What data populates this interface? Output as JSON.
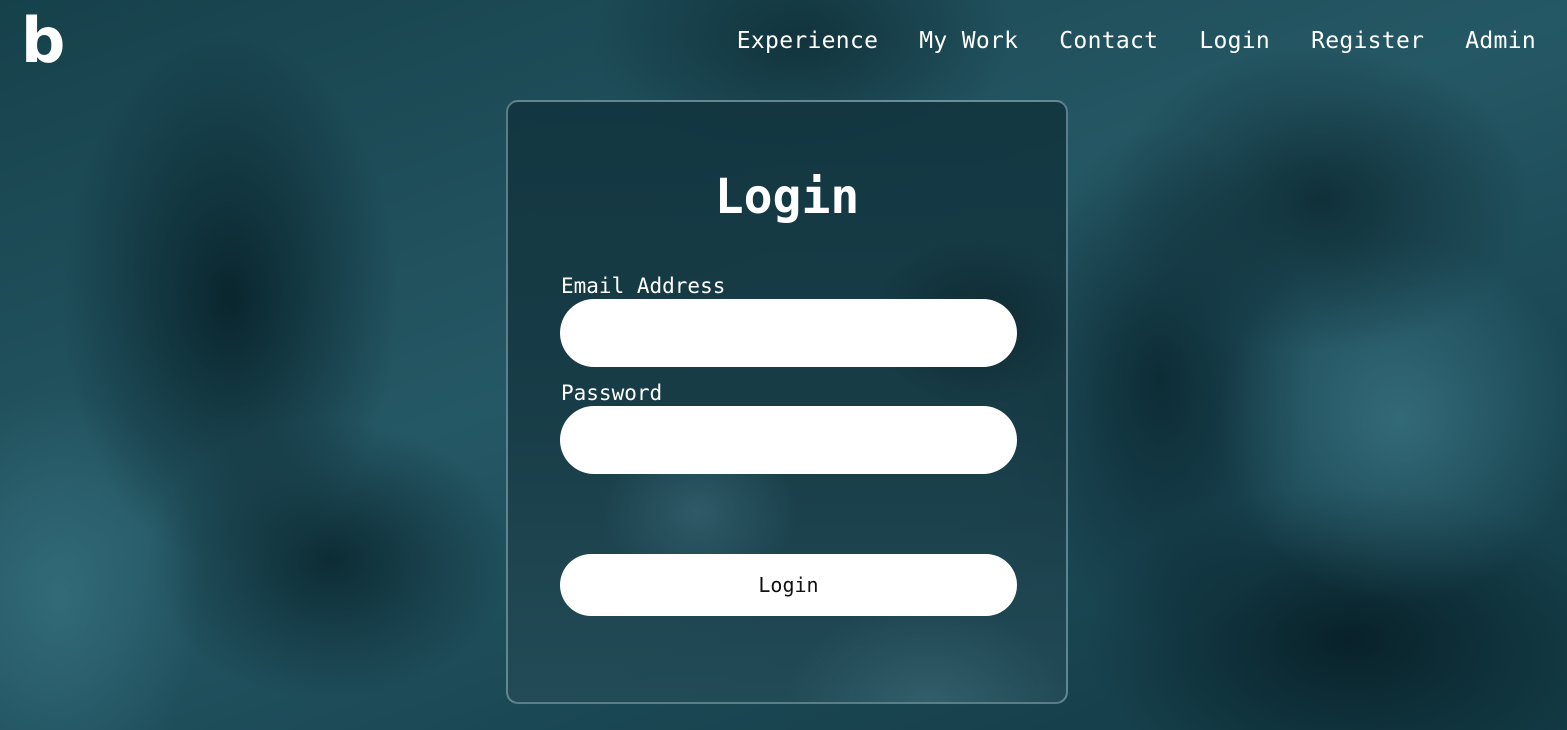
{
  "brand": {
    "logo_text": "b"
  },
  "nav": {
    "items": [
      {
        "label": "Experience"
      },
      {
        "label": "My Work"
      },
      {
        "label": "Contact"
      },
      {
        "label": "Login"
      },
      {
        "label": "Register"
      },
      {
        "label": "Admin"
      }
    ]
  },
  "login_form": {
    "title": "Login",
    "email_label": "Email Address",
    "email_value": "",
    "password_label": "Password",
    "password_value": "",
    "submit_label": "Login"
  },
  "colors": {
    "text": "#ffffff",
    "field_background": "#ffffff",
    "button_text": "#111111",
    "background_accent": "#1f4a55"
  }
}
